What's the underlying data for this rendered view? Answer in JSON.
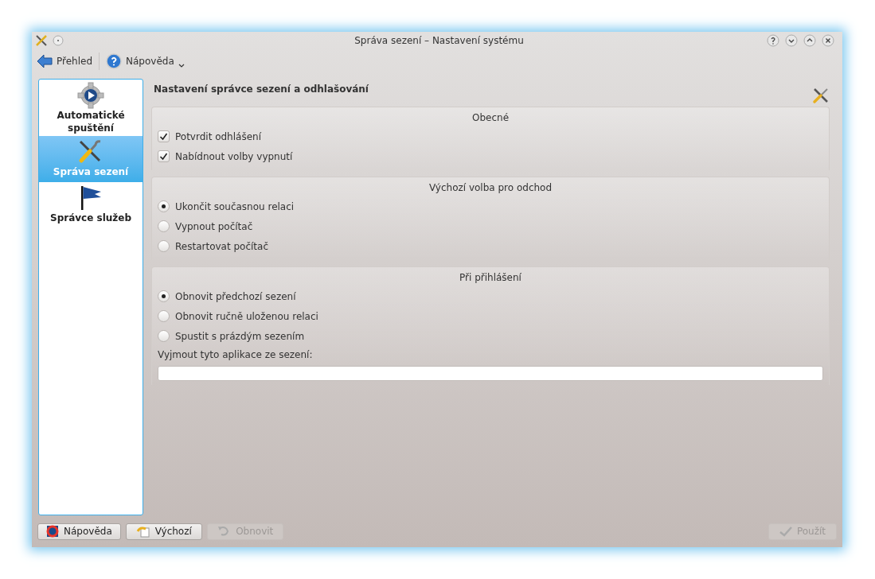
{
  "window": {
    "title": "Správa sezení – Nastavení systému"
  },
  "toolbar": [
    {
      "kind": "back",
      "label": "Přehled"
    },
    {
      "kind": "help",
      "label": "Nápověda",
      "dropdown": true
    }
  ],
  "sidebar": {
    "items": [
      {
        "kind": "gear",
        "label": "Automatické spuštění",
        "selected": false
      },
      {
        "kind": "tools",
        "label": "Správa sezení",
        "selected": true
      },
      {
        "kind": "flag",
        "label": "Správce služeb",
        "selected": false
      }
    ]
  },
  "page": {
    "title": "Nastavení správce sezení a odhlašování",
    "groups": [
      {
        "title": "Obecné",
        "options": [
          {
            "kind": "checkbox",
            "label": "Potvrdit odhlášení",
            "checked": true
          },
          {
            "kind": "checkbox",
            "label": "Nabídnout volby vypnutí",
            "checked": true
          }
        ]
      },
      {
        "title": "Výchozí volba pro odchod",
        "options": [
          {
            "kind": "radio",
            "label": "Ukončit současnou relaci",
            "selected": true
          },
          {
            "kind": "radio",
            "label": "Vypnout počítač",
            "selected": false
          },
          {
            "kind": "radio",
            "label": "Restartovat počítač",
            "selected": false
          }
        ]
      },
      {
        "title": "Při přihlášení",
        "options": [
          {
            "kind": "radio",
            "label": "Obnovit předchozí sezení",
            "selected": true
          },
          {
            "kind": "radio",
            "label": "Obnovit ručně uloženou relaci",
            "selected": false
          },
          {
            "kind": "radio",
            "label": "Spustit s prázdým sezením",
            "selected": false
          }
        ],
        "field": {
          "label": "Vyjmout tyto aplikace ze sezení:"
        }
      }
    ]
  },
  "buttons": [
    {
      "kind": "help",
      "label": "Nápověda",
      "disabled": false
    },
    {
      "kind": "defaults",
      "label": "Výchozí",
      "disabled": false
    },
    {
      "kind": "reset",
      "label": "Obnovit",
      "disabled": true
    },
    {
      "kind": "apply",
      "label": "Použít",
      "disabled": true
    }
  ]
}
